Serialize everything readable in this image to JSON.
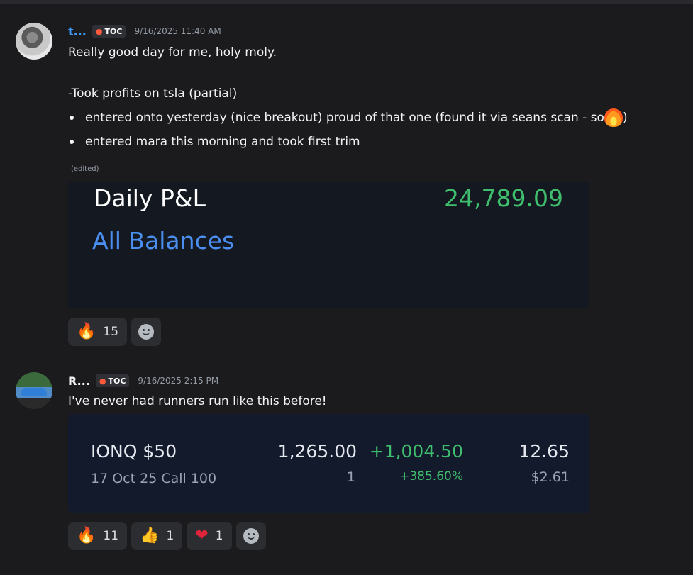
{
  "messages": [
    {
      "username": "t...",
      "tag": "TOC",
      "timestamp": "9/16/2025 11:40 AM",
      "lines": [
        "Really good day for me, holy moly.",
        "-Took profits on tsla (partial)"
      ],
      "bullets": [
        "entered  onto yesterday (nice breakout) proud of that one (found it via seans scan - so ",
        "entered mara this morning and took first trim"
      ],
      "bullet1_suffix": ")",
      "edited_label": "(edited)",
      "embed": {
        "title": "Daily P&L",
        "value": "24,789.09",
        "link": "All Balances"
      },
      "reactions": [
        {
          "emoji": "fire-emoji",
          "glyph": "🔥",
          "count": "15"
        }
      ]
    },
    {
      "username": "R...",
      "tag": "TOC",
      "timestamp": "9/16/2025 2:15 PM",
      "text": "I've never had runners run like this before!",
      "embed": {
        "symbol": "IONQ $50",
        "contract": "17 Oct 25 Call 100",
        "market_value": "1,265.00",
        "quantity": "1",
        "gain": "+1,004.50",
        "gain_pct": "+385.60%",
        "price": "12.65",
        "cost": "$2.61"
      },
      "reactions": [
        {
          "emoji": "fire-emoji",
          "glyph": "🔥",
          "count": "11"
        },
        {
          "emoji": "thumbs-up-emoji",
          "glyph": "👍",
          "count": "1"
        },
        {
          "emoji": "heart-emoji",
          "glyph": "❤",
          "count": "1"
        }
      ]
    }
  ],
  "colors": {
    "background": "#1b1b1e",
    "username1": "#3b9cff",
    "gain_green": "#3fbf6e",
    "link_blue": "#4a8ef0"
  }
}
